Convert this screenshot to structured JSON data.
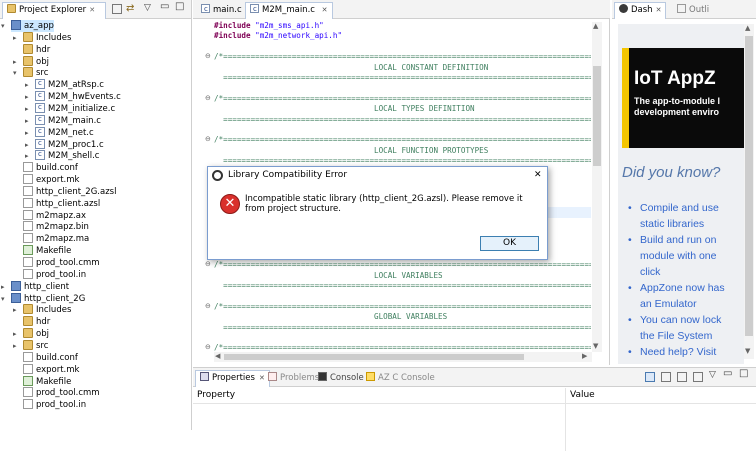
{
  "project_explorer": {
    "title": "Project Explorer",
    "tree": [
      {
        "label": "az_app",
        "icon": "project",
        "depth": 0,
        "expanded": true,
        "selected": true
      },
      {
        "label": "Includes",
        "icon": "includes",
        "depth": 1,
        "expanded": false
      },
      {
        "label": "hdr",
        "icon": "folder",
        "depth": 1
      },
      {
        "label": "obj",
        "icon": "folder",
        "depth": 1,
        "expanded": false
      },
      {
        "label": "src",
        "icon": "folder",
        "depth": 1,
        "expanded": true
      },
      {
        "label": "M2M_atRsp.c",
        "icon": "c-file",
        "depth": 2,
        "expanded": false
      },
      {
        "label": "M2M_hwEvents.c",
        "icon": "c-file",
        "depth": 2,
        "expanded": false
      },
      {
        "label": "M2M_initialize.c",
        "icon": "c-file",
        "depth": 2,
        "expanded": false
      },
      {
        "label": "M2M_main.c",
        "icon": "c-file",
        "depth": 2,
        "expanded": false
      },
      {
        "label": "M2M_net.c",
        "icon": "c-file",
        "depth": 2,
        "expanded": false
      },
      {
        "label": "M2M_proc1.c",
        "icon": "c-file",
        "depth": 2,
        "expanded": false
      },
      {
        "label": "M2M_shell.c",
        "icon": "c-file",
        "depth": 2,
        "expanded": false
      },
      {
        "label": "build.conf",
        "icon": "file",
        "depth": 1
      },
      {
        "label": "export.mk",
        "icon": "file",
        "depth": 1
      },
      {
        "label": "http_client_2G.azsl",
        "icon": "file",
        "depth": 1
      },
      {
        "label": "http_client.azsl",
        "icon": "file",
        "depth": 1
      },
      {
        "label": "m2mapz.ax",
        "icon": "file",
        "depth": 1
      },
      {
        "label": "m2mapz.bin",
        "icon": "file",
        "depth": 1
      },
      {
        "label": "m2mapz.ma",
        "icon": "file",
        "depth": 1
      },
      {
        "label": "Makefile",
        "icon": "makefile",
        "depth": 1
      },
      {
        "label": "prod_tool.cmm",
        "icon": "file",
        "depth": 1
      },
      {
        "label": "prod_tool.in",
        "icon": "file",
        "depth": 1
      },
      {
        "label": "http_client",
        "icon": "project",
        "depth": 0,
        "expanded": false
      },
      {
        "label": "http_client_2G",
        "icon": "project",
        "depth": 0,
        "expanded": true
      },
      {
        "label": "Includes",
        "icon": "includes",
        "depth": 1,
        "expanded": false
      },
      {
        "label": "hdr",
        "icon": "folder",
        "depth": 1
      },
      {
        "label": "obj",
        "icon": "folder",
        "depth": 1,
        "expanded": false
      },
      {
        "label": "src",
        "icon": "folder",
        "depth": 1,
        "expanded": false
      },
      {
        "label": "build.conf",
        "icon": "file",
        "depth": 1
      },
      {
        "label": "export.mk",
        "icon": "file",
        "depth": 1
      },
      {
        "label": "Makefile",
        "icon": "makefile",
        "depth": 1
      },
      {
        "label": "prod_tool.cmm",
        "icon": "file",
        "depth": 1
      },
      {
        "label": "prod_tool.in",
        "icon": "file",
        "depth": 1
      }
    ]
  },
  "editor": {
    "tabs": [
      {
        "label": "main.c",
        "active": false
      },
      {
        "label": "M2M_main.c",
        "active": true,
        "close": "✕"
      }
    ],
    "lines": [
      {
        "text": "#include \"m2m_sms_api.h\"",
        "kind": "include"
      },
      {
        "text": "#include \"m2m_network_api.h\"",
        "kind": "include"
      },
      {
        "text": "",
        "kind": "blank"
      },
      {
        "text": "/*=============================================================================================",
        "kind": "comment",
        "fold": true
      },
      {
        "text": "                                   LOCAL CONSTANT DEFINITION",
        "kind": "comment"
      },
      {
        "text": "  =============================================================================================",
        "kind": "comment"
      },
      {
        "text": "",
        "kind": "blank"
      },
      {
        "text": "/*=============================================================================================",
        "kind": "comment",
        "fold": true
      },
      {
        "text": "                                   LOCAL TYPES DEFINITION",
        "kind": "comment"
      },
      {
        "text": "  =============================================================================================",
        "kind": "comment"
      },
      {
        "text": "",
        "kind": "blank"
      },
      {
        "text": "/*=============================================================================================",
        "kind": "comment",
        "fold": true
      },
      {
        "text": "                                   LOCAL FUNCTION PROTOTYPES",
        "kind": "comment"
      },
      {
        "text": "  =============================================================================================",
        "kind": "comment"
      },
      {
        "text": "",
        "kind": "blank"
      },
      {
        "text": "",
        "kind": "blank"
      },
      {
        "text": "",
        "kind": "blank"
      },
      {
        "text": "",
        "kind": "blank"
      },
      {
        "text": "",
        "kind": "blank"
      },
      {
        "text": "",
        "kind": "blank"
      },
      {
        "text": "",
        "kind": "blank"
      },
      {
        "text": "",
        "kind": "blank"
      },
      {
        "text": "",
        "kind": "blank"
      },
      {
        "text": "/*=============================================================================================",
        "kind": "comment",
        "fold": true
      },
      {
        "text": "                                   LOCAL VARIABLES",
        "kind": "comment"
      },
      {
        "text": "  =============================================================================================",
        "kind": "comment"
      },
      {
        "text": "",
        "kind": "blank"
      },
      {
        "text": "/*=============================================================================================",
        "kind": "comment",
        "fold": true
      },
      {
        "text": "                                   GLOBAL VARIABLES",
        "kind": "comment"
      },
      {
        "text": "  =============================================================================================",
        "kind": "comment"
      },
      {
        "text": "",
        "kind": "blank"
      },
      {
        "text": "/*=============================================================================================",
        "kind": "comment",
        "fold": true
      }
    ],
    "highlight_line": 18
  },
  "dashboard": {
    "tabs": [
      {
        "label": "Dash",
        "active": true
      },
      {
        "label": "Outli",
        "active": false
      }
    ],
    "banner_title": "IoT AppZ",
    "banner_line1": "The app-to-module l",
    "banner_line2": "development enviro",
    "heading": "Did you know?",
    "tips": [
      "Compile and use static libraries",
      "Build and run on module with one click",
      "AppZone now has an Emulator",
      "You can now lock the File System",
      "Need help? Visit"
    ]
  },
  "bottom_panel": {
    "tabs": [
      {
        "label": "Properties",
        "active": true
      },
      {
        "label": "Problems",
        "active": false
      },
      {
        "label": "Console",
        "active": false
      },
      {
        "label": "AZ C Console",
        "active": false
      }
    ],
    "columns": [
      "Property",
      "Value"
    ]
  },
  "dialog": {
    "title": "Library Compatibility Error",
    "message": "Incompatible static library (http_client_2G.azsl). Please remove it from project structure.",
    "ok_label": "OK",
    "close_glyph": "✕"
  },
  "colors": {
    "tip_blue": "#3366cc",
    "heading_blue": "#5577aa",
    "error_red": "#d9302c",
    "selection": "#cce8ff",
    "line_highlight": "#e8f2fe"
  }
}
